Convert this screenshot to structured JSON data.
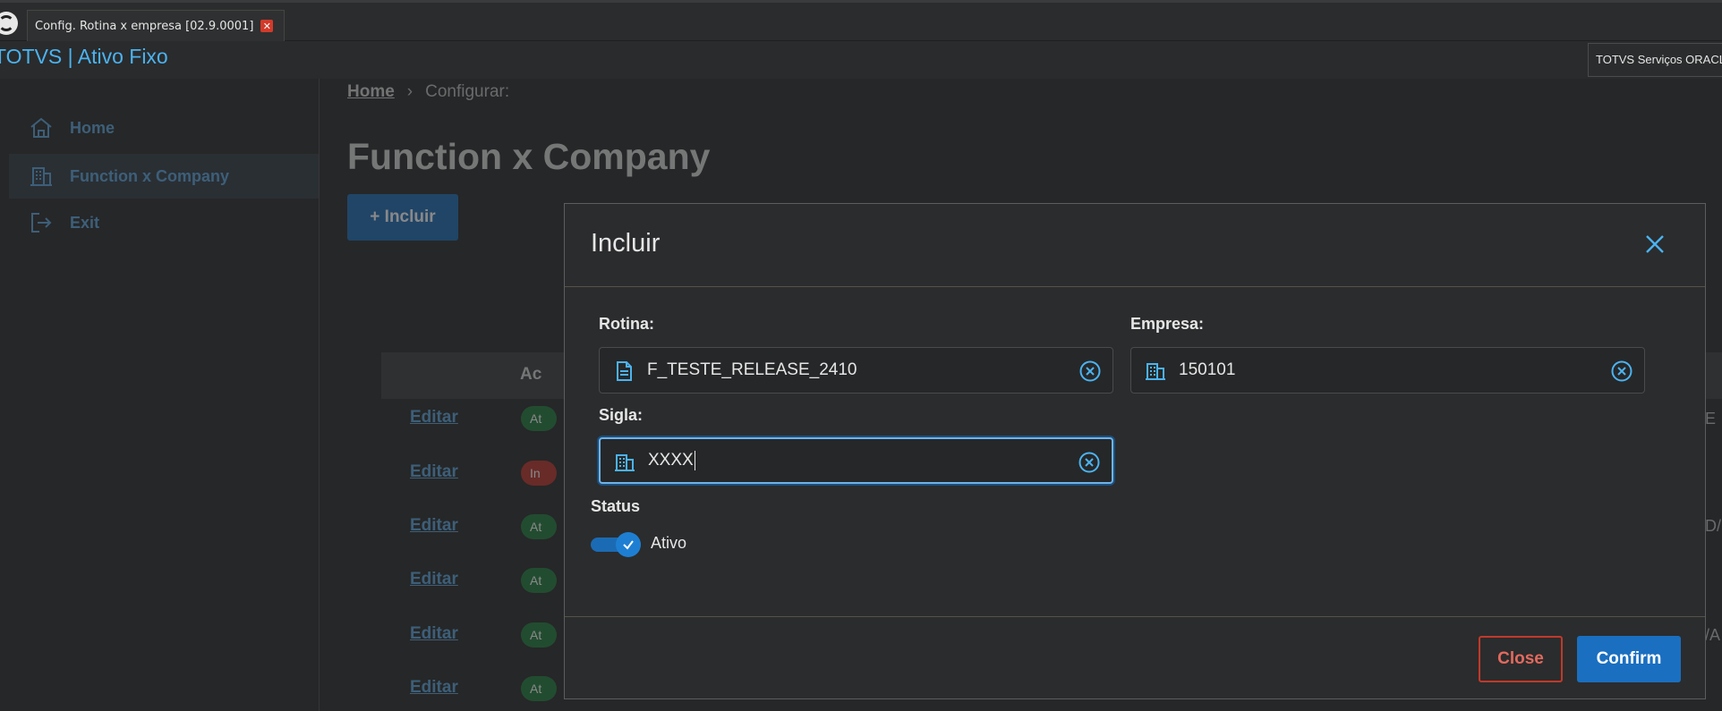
{
  "tab": {
    "title": "Config. Rotina x empresa [02.9.0001]"
  },
  "app": {
    "title": "TOTVS | Ativo Fixo",
    "company": "TOTVS Serviços ORACLE"
  },
  "sidebar": {
    "items": [
      {
        "label": "Home",
        "icon": "home-icon"
      },
      {
        "label": "Function x Company",
        "icon": "building-icon"
      },
      {
        "label": "Exit",
        "icon": "exit-icon"
      }
    ]
  },
  "breadcrumb": {
    "home": "Home",
    "current": "Configurar:"
  },
  "page": {
    "title": "Function x Company",
    "add_label": "Incluir"
  },
  "table": {
    "header_partial": "Ac",
    "edit_label": "Editar",
    "rows": [
      {
        "status": "Ativo",
        "status_partial": "At",
        "edge": "E"
      },
      {
        "status": "Inativo",
        "status_partial": "In",
        "edge": ""
      },
      {
        "status": "Ativo",
        "status_partial": "At",
        "edge": "D/"
      },
      {
        "status": "Ativo",
        "status_partial": "At",
        "edge": ""
      },
      {
        "status": "Ativo",
        "status_partial": "At",
        "edge": "/A"
      },
      {
        "status": "Ativo",
        "status_partial": "At",
        "edge": ""
      }
    ]
  },
  "modal": {
    "title": "Incluir",
    "rotina": {
      "label": "Rotina:",
      "value": "F_TESTE_RELEASE_2410"
    },
    "empresa": {
      "label": "Empresa:",
      "value": "150101"
    },
    "sigla": {
      "label": "Sigla:",
      "value": "XXXX"
    },
    "status": {
      "label": "Status",
      "toggle_label": "Ativo",
      "on": true
    },
    "close_label": "Close",
    "confirm_label": "Confirm"
  },
  "colors": {
    "accent": "#4bb3f0",
    "primary": "#1a6fc0",
    "danger": "#c0392b"
  }
}
